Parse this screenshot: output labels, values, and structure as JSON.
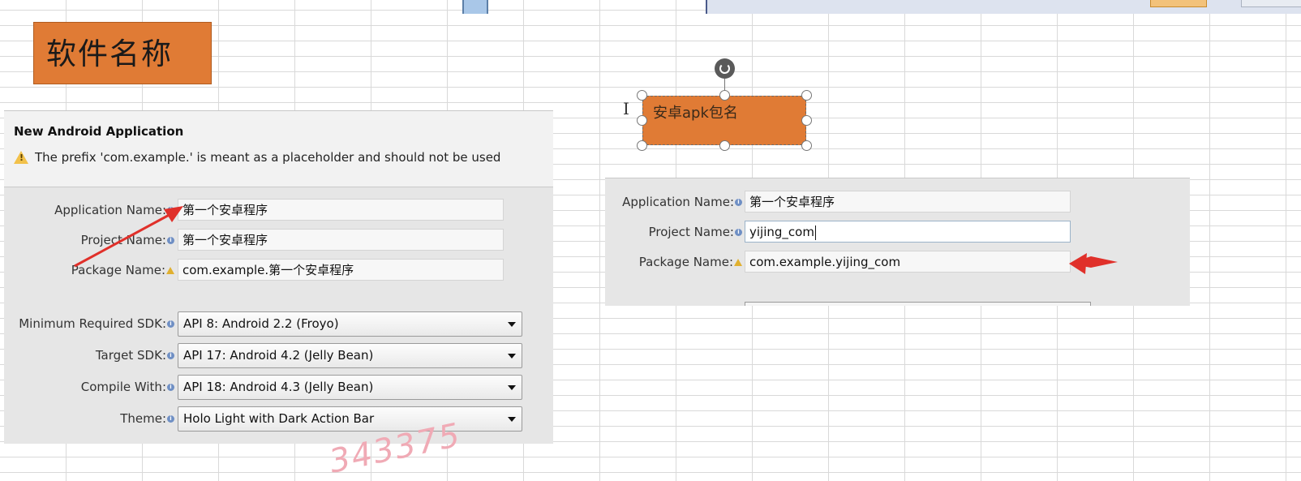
{
  "background": {
    "sheet_title_label": "软件名称",
    "selected_shape_label": "安卓apk包名",
    "watermark": "343375"
  },
  "left_dialog": {
    "title": "New Android Application",
    "warning": "The prefix 'com.example.' is meant as a placeholder and should not be used",
    "fields": {
      "application_name": {
        "label": "Application Name:",
        "value": "第一个安卓程序"
      },
      "project_name": {
        "label": "Project Name:",
        "value": "第一个安卓程序"
      },
      "package_name": {
        "label": "Package Name:",
        "value": "com.example.第一个安卓程序"
      }
    },
    "selects": {
      "min_sdk": {
        "label": "Minimum Required SDK:",
        "value": "API 8: Android 2.2 (Froyo)"
      },
      "target_sdk": {
        "label": "Target SDK:",
        "value": "API 17: Android 4.2 (Jelly Bean)"
      },
      "compile_with": {
        "label": "Compile With:",
        "value": "API 18: Android 4.3 (Jelly Bean)"
      },
      "theme": {
        "label": "Theme:",
        "value": "Holo Light with Dark Action Bar"
      }
    }
  },
  "right_dialog": {
    "fields": {
      "application_name": {
        "label": "Application Name:",
        "value": "第一个安卓程序"
      },
      "project_name": {
        "label": "Project Name:",
        "value": "yijing_com"
      },
      "package_name": {
        "label": "Package Name:",
        "value": "com.example.yijing_com"
      }
    }
  },
  "colors": {
    "shape_fill": "#e07b35",
    "annotation_arrow": "#e0302a"
  },
  "icons": [
    "info-icon",
    "warning-icon",
    "dropdown-caret-icon",
    "rotate-handle-icon",
    "ibeam-cursor-icon",
    "red-arrow-icon"
  ]
}
